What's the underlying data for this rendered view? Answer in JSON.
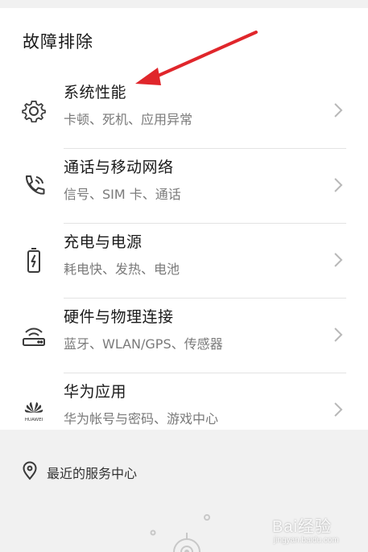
{
  "section_title": "故障排除",
  "items": [
    {
      "title": "系统性能",
      "subtitle": "卡顿、死机、应用异常",
      "icon": "gear-icon"
    },
    {
      "title": "通话与移动网络",
      "subtitle": "信号、SIM 卡、通话",
      "icon": "phone-icon"
    },
    {
      "title": "充电与电源",
      "subtitle": "耗电快、发热、电池",
      "icon": "battery-icon"
    },
    {
      "title": "硬件与物理连接",
      "subtitle": "蓝牙、WLAN/GPS、传感器",
      "icon": "router-icon"
    },
    {
      "title": "华为应用",
      "subtitle": "华为帐号与密码、游戏中心",
      "icon": "huawei-logo-icon"
    }
  ],
  "huawei_logo_text": "HUAWEI",
  "service_center": {
    "label": "最近的服务中心",
    "icon": "location-pin-icon"
  },
  "watermark": {
    "main": "Bai经验",
    "sub": "jingyan.baidu.com"
  },
  "colors": {
    "arrow": "#e0262b",
    "text": "#1a1a1a",
    "subtext": "#7a7a7a",
    "background": "#f1f1f1"
  }
}
